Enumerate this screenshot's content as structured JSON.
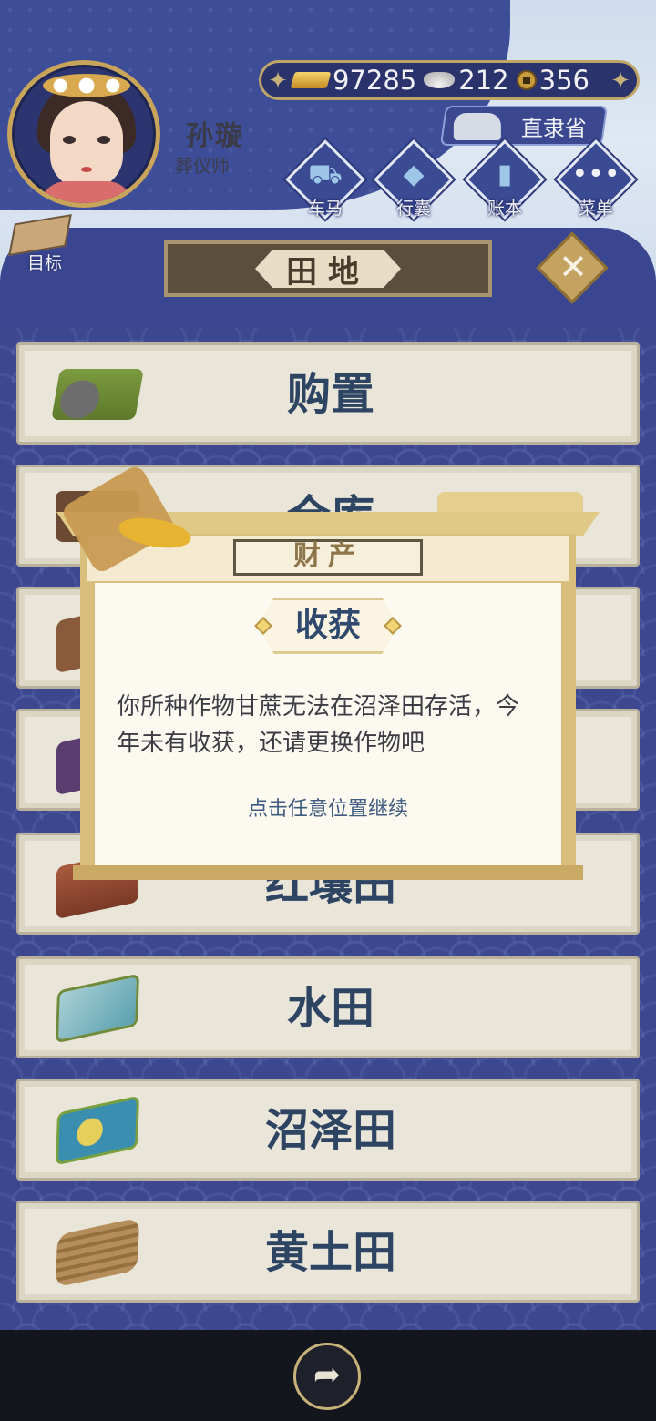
{
  "player": {
    "name": "孙璇",
    "title": "葬仪师"
  },
  "currency": {
    "gold": "97285",
    "silver": "212",
    "coins": "356"
  },
  "province": "直隶省",
  "nav": [
    {
      "label": "车马",
      "icon": "carriage-icon"
    },
    {
      "label": "行囊",
      "icon": "bag-icon"
    },
    {
      "label": "账本",
      "icon": "ledger-icon"
    },
    {
      "label": "菜单",
      "icon": "menu-dots-icon"
    }
  ],
  "goal_label": "目标",
  "panel_title": "田地",
  "rows": [
    {
      "label": "购置",
      "icon": "buy-land-icon"
    },
    {
      "label": "仓库",
      "icon": "warehouse-icon"
    },
    {
      "label": "",
      "icon": "dry-field-icon"
    },
    {
      "label": "",
      "icon": "purple-field-icon"
    },
    {
      "label": "红壤田",
      "icon": "red-soil-field-icon"
    },
    {
      "label": "水田",
      "icon": "paddy-field-icon"
    },
    {
      "label": "沼泽田",
      "icon": "swamp-field-icon"
    },
    {
      "label": "黄土田",
      "icon": "loess-field-icon"
    }
  ],
  "modal": {
    "header": "财产",
    "title": "收获",
    "message": "你所种作物甘蔗无法在沼泽田存活，今年未有收获，还请更换作物吧",
    "hint": "点击任意位置继续"
  }
}
